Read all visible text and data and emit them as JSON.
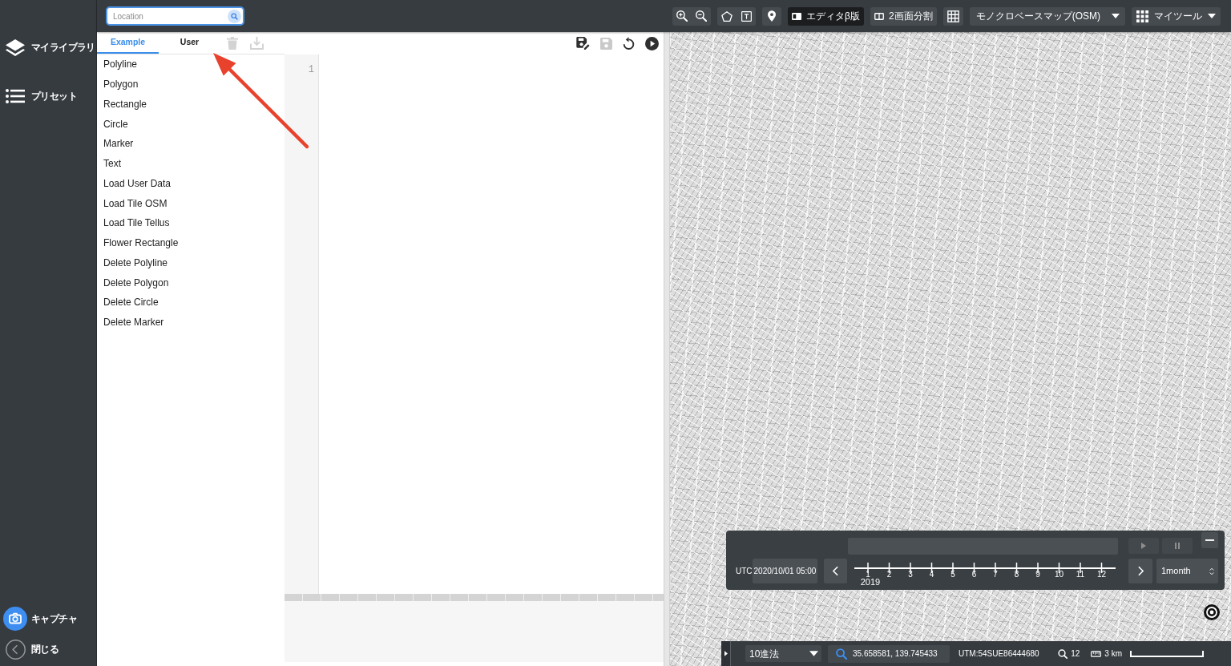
{
  "sidebar": {
    "items": [
      {
        "kind": "layers",
        "label": "マイライブラリ"
      },
      {
        "kind": "list",
        "label": "プリセット"
      }
    ],
    "bottom_items": [
      {
        "kind": "camera",
        "label": "キャプチャ"
      },
      {
        "kind": "back",
        "label": "閉じる"
      }
    ]
  },
  "top_bar": {
    "search": {
      "placeholder": "Location"
    },
    "tool_groups": [
      [
        {
          "kind": "zoom_in",
          "active": false
        },
        {
          "kind": "zoom_out",
          "active": false
        }
      ],
      [
        {
          "kind": "polygon",
          "active": false
        },
        {
          "kind": "text",
          "active": false
        }
      ],
      [
        {
          "kind": "marker",
          "active": false
        }
      ],
      [
        {
          "kind": "editor",
          "label": "エディタβ版",
          "active": true
        }
      ],
      [
        {
          "kind": "split",
          "label": "2画面分割",
          "active": false
        }
      ],
      [
        {
          "kind": "grid",
          "active": false
        }
      ],
      [
        {
          "kind": "dropdown",
          "label": "モノクロベースマップ(OSM)",
          "active": false
        }
      ],
      [
        {
          "kind": "menu",
          "label": "マイツール",
          "active": false
        }
      ]
    ]
  },
  "editor": {
    "tabs": [
      {
        "label": "Example",
        "selected": true
      },
      {
        "label": "User",
        "selected": false
      }
    ],
    "tab_actions": [
      {
        "kind": "delete",
        "disabled": true
      },
      {
        "kind": "download",
        "disabled": true
      }
    ],
    "examples": [
      "Polyline",
      "Polygon",
      "Rectangle",
      "Circle",
      "Marker",
      "Text",
      "Load User Data",
      "Load Tile OSM",
      "Load Tile Tellus",
      "Flower Rectangle",
      "Delete Polyline",
      "Delete Polygon",
      "Delete Circle",
      "Delete Marker"
    ],
    "toolbar": [
      {
        "kind": "save_as",
        "disabled": false
      },
      {
        "kind": "save",
        "disabled": true
      },
      {
        "kind": "reset",
        "disabled": false
      },
      {
        "kind": "run",
        "disabled": false
      }
    ],
    "line_numbers": [
      "1"
    ]
  },
  "map": {
    "timeline": {
      "timezone": "UTC",
      "datetime": "2020/10/01 05:00",
      "months": [
        "1",
        "2",
        "3",
        "4",
        "5",
        "6",
        "7",
        "8",
        "9",
        "10",
        "11",
        "12"
      ],
      "year": "2019",
      "step": "1month"
    },
    "status_bar": {
      "format": "10進法",
      "coordinates": "35.658581, 139.745433",
      "utm": "UTM:54SUE86444680",
      "zoom": "12",
      "scale": "3 km"
    }
  }
}
